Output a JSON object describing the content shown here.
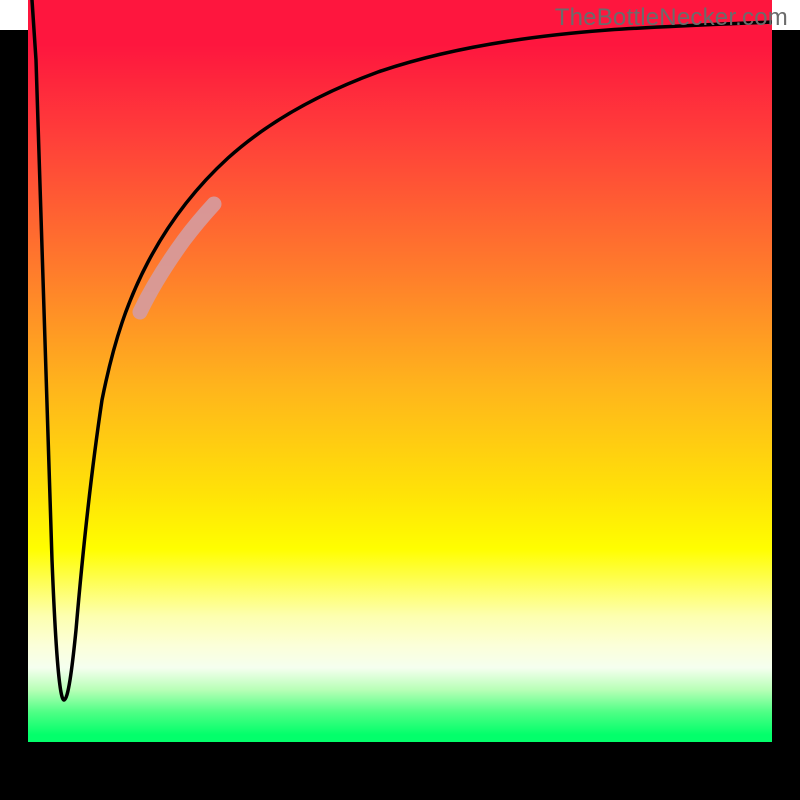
{
  "watermark": "TheBottleNecker.com",
  "chart_data": {
    "type": "line",
    "title": "",
    "xlabel": "",
    "ylabel": "",
    "xlim": [
      0,
      100
    ],
    "ylim": [
      0,
      100
    ],
    "note": "Axes are unlabeled; values are normalized 0–100 estimated from pixel positions. Y increases upward (0 at bottom, 100 at top). The curve plunges from ~100 to ~6 near x≈3–5, then rises steeply and asymptotically toward ~96 at the right edge. A pale segment highlights the curve roughly over x≈15–24.",
    "series": [
      {
        "name": "curve",
        "x": [
          0.5,
          1.5,
          2.5,
          3.5,
          4.5,
          5.5,
          6.5,
          8,
          10,
          12,
          15,
          18,
          22,
          26,
          32,
          40,
          50,
          62,
          76,
          90,
          100
        ],
        "y": [
          100,
          80,
          50,
          20,
          7,
          6,
          10,
          22,
          35,
          46,
          58,
          66,
          73,
          78,
          83,
          87,
          90,
          92.5,
          94,
          95.2,
          96
        ]
      }
    ],
    "highlight_range_x": [
      15,
      24
    ],
    "background_gradient": {
      "top": "#fe163e",
      "mid": "#fffe00",
      "bottom": "#03ff6b"
    }
  }
}
